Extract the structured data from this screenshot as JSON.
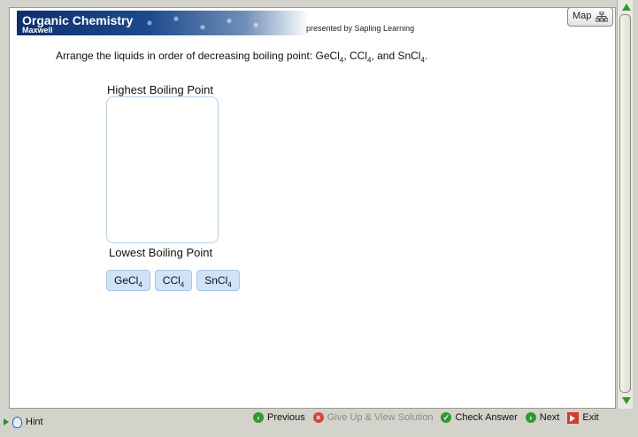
{
  "header": {
    "title": "Organic Chemistry",
    "subtitle": "Maxwell",
    "presented_by": "presented by Sapling Learning",
    "map_label": "Map"
  },
  "question": {
    "text": "Arrange the liquids in order of decreasing boiling point: GeCl",
    "sub1": "4",
    "mid1": ", CCl",
    "sub2": "4",
    "mid2": ", and SnCl",
    "sub3": "4",
    "end": "."
  },
  "ranking": {
    "top_label": "Highest Boiling Point",
    "bottom_label": "Lowest Boiling Point"
  },
  "tiles": [
    {
      "base": "GeCl",
      "sub": "4"
    },
    {
      "base": "CCl",
      "sub": "4"
    },
    {
      "base": "SnCl",
      "sub": "4"
    }
  ],
  "footer": {
    "hint": "Hint",
    "previous": "Previous",
    "give_up": "Give Up & View Solution",
    "check": "Check Answer",
    "next": "Next",
    "exit": "Exit"
  },
  "colors": {
    "banner_dark": "#0d2f6d",
    "tile_bg": "#cfe2f6",
    "nav_green": "#2f9a2f",
    "nav_red": "#d04a3a"
  }
}
